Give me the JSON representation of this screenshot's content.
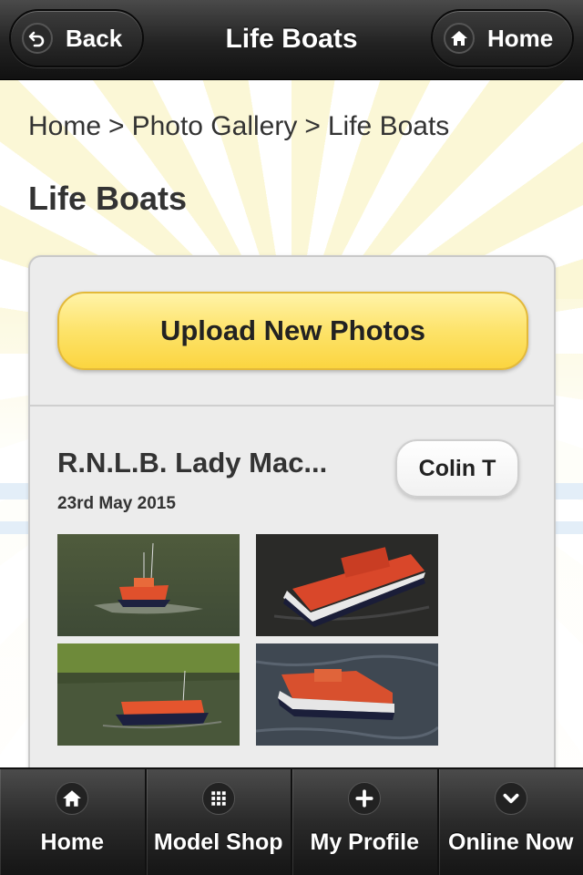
{
  "header": {
    "title": "Life Boats",
    "back_label": "Back",
    "home_label": "Home"
  },
  "breadcrumb": {
    "items": [
      "Home",
      "Photo Gallery",
      "Life Boats"
    ],
    "separator": ">"
  },
  "page_title": "Life Boats",
  "upload_label": "Upload New Photos",
  "album": {
    "title": "R.N.L.B. Lady Mac...",
    "date": "23rd May 2015",
    "author": "Colin T"
  },
  "footer": {
    "tabs": [
      {
        "label": "Home",
        "icon": "home-icon"
      },
      {
        "label": "Model Shop",
        "icon": "grid-icon"
      },
      {
        "label": "My Profile",
        "icon": "plus-icon"
      },
      {
        "label": "Online Now",
        "icon": "chevron-down-icon"
      }
    ]
  },
  "colors": {
    "header_bg": "#222222",
    "upload_button": "#fde36a",
    "card_bg": "#ececec"
  }
}
